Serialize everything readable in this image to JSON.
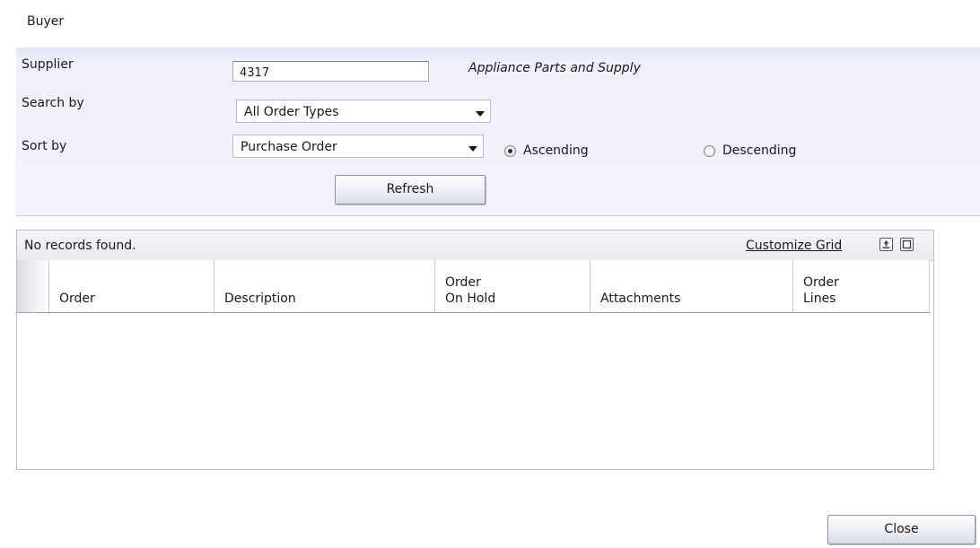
{
  "header": {
    "title": "Buyer"
  },
  "criteria": {
    "supplier_label": "Supplier",
    "supplier_value": "4317",
    "supplier_name": "Appliance Parts and Supply",
    "search_by_label": "Search by",
    "search_by_value": "All Order Types",
    "sort_by_label": "Sort by",
    "sort_by_value": "Purchase Order",
    "sort_order": {
      "options": [
        "Ascending",
        "Descending"
      ],
      "selected": "Ascending"
    },
    "refresh_label": "Refresh"
  },
  "grid": {
    "status": "No records found.",
    "customize_label": "Customize Grid",
    "columns": [
      {
        "line1": "",
        "line2": "Order"
      },
      {
        "line1": "",
        "line2": "Description"
      },
      {
        "line1": "Order",
        "line2": "On Hold"
      },
      {
        "line1": "",
        "line2": "Attachments"
      },
      {
        "line1": "Order",
        "line2": "Lines"
      }
    ],
    "rows": []
  },
  "footer": {
    "close_label": "Close"
  },
  "icons": [
    "export-icon",
    "maximize-icon",
    "dropdown-caret-icon",
    "radio-icon"
  ]
}
